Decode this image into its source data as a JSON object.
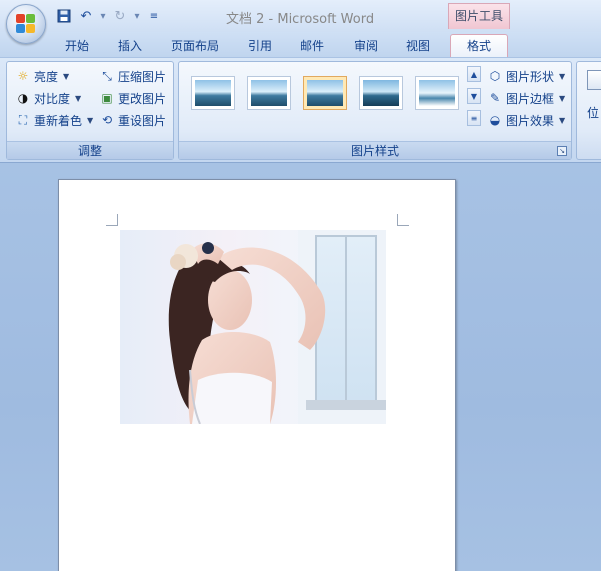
{
  "title_bar": {
    "doc_title": "文档 2 - Microsoft Word",
    "contextual_tab_title": "图片工具"
  },
  "tabs": [
    "开始",
    "插入",
    "页面布局",
    "引用",
    "邮件",
    "审阅",
    "视图"
  ],
  "active_tab": "格式",
  "ribbon": {
    "adjust": {
      "label": "调整",
      "brightness": "亮度",
      "contrast": "对比度",
      "recolor": "重新着色",
      "compress": "压缩图片",
      "change": "更改图片",
      "reset": "重设图片"
    },
    "picture_styles": {
      "label": "图片样式",
      "shape": "图片形状",
      "border": "图片边框",
      "effects": "图片效果"
    },
    "arrange": {
      "position": "位"
    }
  },
  "colors": {
    "accent": "#15428b",
    "contextual": "#f0c6d2",
    "workspace": "#a7c2e4"
  }
}
